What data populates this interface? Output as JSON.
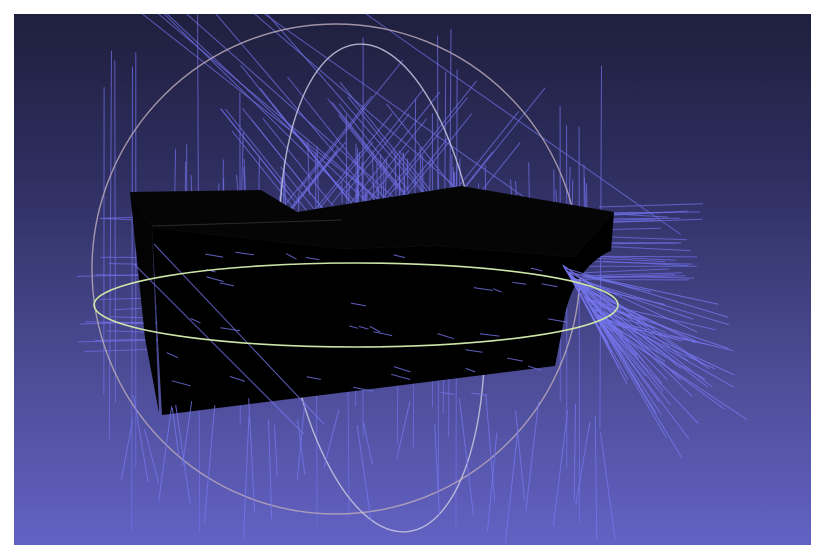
{
  "viewer": {
    "background_top": "#1f1f3e",
    "background_bottom": "#6262c4",
    "mesh_color": "#000000",
    "normals_color": "#6f6fe6",
    "trackball_horizontal_ring_color": "#cde6a8",
    "trackball_vertical_ring_color": "#c8c8e0",
    "trackball_side_ring_color": "#b8a8b8"
  },
  "scene_objects": [
    {
      "name": "mesh",
      "icon": "box-mesh-icon"
    },
    {
      "name": "vertex-normals",
      "icon": "normals-icon"
    },
    {
      "name": "trackball",
      "icon": "trackball-icon"
    }
  ]
}
